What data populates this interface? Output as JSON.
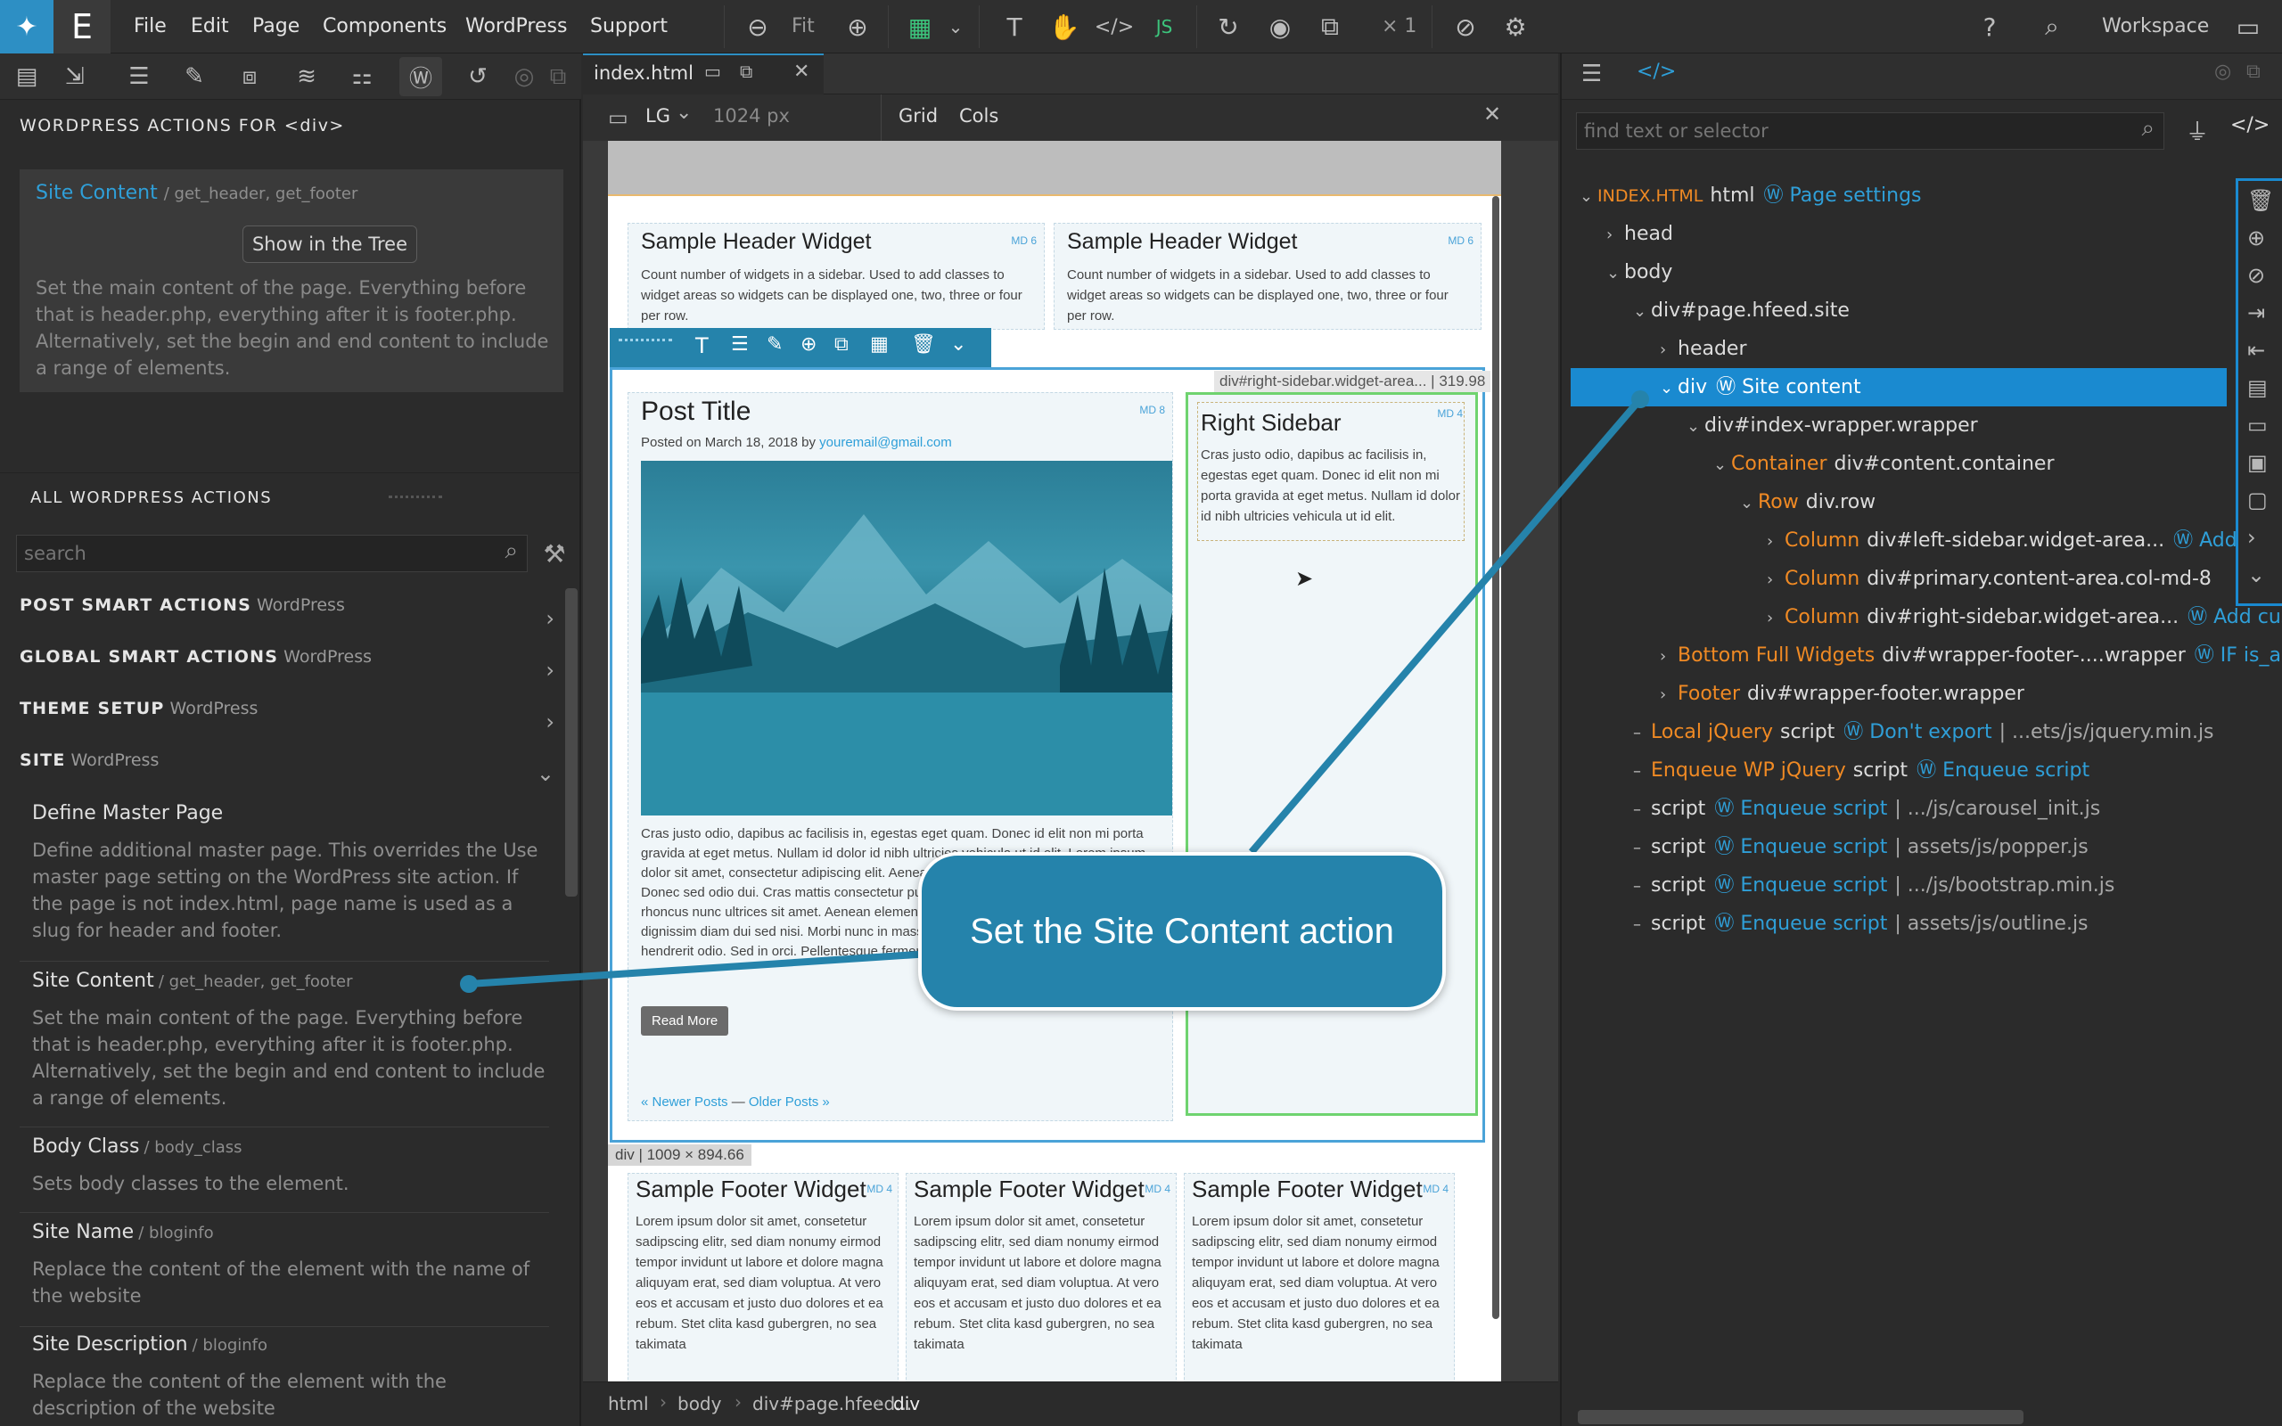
{
  "menubar": {
    "items": [
      "File",
      "Edit",
      "Page",
      "Components",
      "WordPress",
      "Support"
    ],
    "fit_label": "Fit",
    "multiplier": "× 1",
    "workspace": "Workspace"
  },
  "left_panel": {
    "heading": "WORDPRESS ACTIONS FOR  <div>",
    "current_action": {
      "title": "Site Content",
      "sub": "/ get_header, get_footer",
      "button": "Show in the Tree",
      "description": "Set the main content of the page. Everything before that is header.php, everything after it is footer.php. Alternatively, set the begin and end content to include a range of elements."
    },
    "all_heading": "ALL WORDPRESS ACTIONS",
    "search_placeholder": "search",
    "categories": [
      {
        "title": "POST SMART ACTIONS",
        "sub": "WordPress"
      },
      {
        "title": "GLOBAL SMART ACTIONS",
        "sub": "WordPress"
      },
      {
        "title": "THEME SETUP",
        "sub": "WordPress"
      },
      {
        "title": "SITE",
        "sub": "WordPress"
      }
    ],
    "actions": [
      {
        "title": "Define Master Page",
        "sub": "",
        "description": "Define additional master page. This overrides the Use master page setting on the WordPress site action. If the page is not index.html, page name is used as a slug for header and footer."
      },
      {
        "title": "Site Content",
        "sub": "/ get_header, get_footer",
        "description": "Set the main content of the page. Everything before that is header.php, everything after it is footer.php. Alternatively, set the begin and end content to include a range of elements."
      },
      {
        "title": "Body Class",
        "sub": "/ body_class",
        "description": "Sets body classes to the element."
      },
      {
        "title": "Site Name",
        "sub": "/ bloginfo",
        "description": "Replace the content of the element with the name of the website"
      },
      {
        "title": "Site Description",
        "sub": "/ bloginfo",
        "description": "Replace the content of the element with the description of the website"
      }
    ]
  },
  "center": {
    "tab_name": "index.html",
    "viewport": "LG",
    "viewport_px": "1024 px",
    "grid": "Grid",
    "cols": "Cols",
    "breadcrumb": [
      "html",
      "body",
      "div#page.hfeed...",
      "div"
    ],
    "page": {
      "header_widgets": [
        {
          "title": "Sample Header Widget",
          "md": "MD 6",
          "text": "Count number of widgets in a sidebar. Used to add classes to widget areas so widgets can be displayed one, two, three or four per row."
        },
        {
          "title": "Sample Header Widget",
          "md": "MD 6",
          "text": "Count number of widgets in a sidebar. Used to add classes to widget areas so widgets can be displayed one, two, three or four per row."
        }
      ],
      "post": {
        "title": "Post Title",
        "md": "MD 8",
        "meta_prefix": "Posted on March 18, 2018 by",
        "meta_email": "youremail@gmail.com",
        "body": "Cras justo odio, dapibus ac facilisis in, egestas eget quam. Donec id elit non mi porta gravida at eget metus. Nullam id dolor id nibh ultricies vehicula ut id elit. Lorem ipsum dolor sit amet, consectetur adipiscing elit. Aenean lacinia bibendum nulla sed consectetur. Donec sed odio dui. Cras mattis consectetur purus sit amet fermentum. neque, nec rhoncus nunc ultrices sit amet. Aenean elementum, erat at aliquet hendrerit, elit nisi dignissim diam dui sed nisi. Morbi nunc in massa ut lectus. fringilla. Maecenas at hendrerit odio. Sed in orci. Pellentesque fermentum nisl purus, et iaculis",
        "read_more": "Read More",
        "newer": "« Newer Posts",
        "dash": "—",
        "older": "Older Posts »"
      },
      "sidebar": {
        "label": "div#right-sidebar.widget-area... | 319.98",
        "title": "Right Sidebar",
        "md": "MD 4",
        "text": "Cras justo odio, dapibus ac facilisis in, egestas eget quam. Donec id elit non mi porta gravida at eget metus. Nullam id dolor id nibh ultricies vehicula ut id elit."
      },
      "div_size": "div | 1009 × 894.66",
      "footer_widgets": [
        {
          "title": "Sample Footer Widget",
          "md": "MD 4",
          "text": "Lorem ipsum dolor sit amet, consetetur sadipscing elitr, sed diam nonumy eirmod tempor invidunt ut labore et dolore magna aliquyam erat, sed diam voluptua. At vero eos et accusam et justo duo dolores et ea rebum. Stet clita kasd gubergren, no sea takimata"
        },
        {
          "title": "Sample Footer Widget",
          "md": "MD 4",
          "text": "Lorem ipsum dolor sit amet, consetetur sadipscing elitr, sed diam nonumy eirmod tempor invidunt ut labore et dolore magna aliquyam erat, sed diam voluptua. At vero eos et accusam et justo duo dolores et ea rebum. Stet clita kasd gubergren, no sea takimata"
        },
        {
          "title": "Sample Footer Widget",
          "md": "MD 4",
          "text": "Lorem ipsum dolor sit amet, consetetur sadipscing elitr, sed diam nonumy eirmod tempor invidunt ut labore et dolore magna aliquyam erat, sed diam voluptua. At vero eos et accusam et justo duo dolores et ea rebum. Stet clita kasd gubergren, no sea takimata"
        }
      ]
    }
  },
  "callout": "Set the Site Content action",
  "right_panel": {
    "search_placeholder": "find text or selector",
    "tree": [
      {
        "depth": 0,
        "caret": "v",
        "tag": "INDEX.HTML",
        "name": "html",
        "wp": "Page settings",
        "rest": ""
      },
      {
        "depth": 1,
        "caret": ">",
        "tag": "",
        "name": "head",
        "wp": "",
        "rest": ""
      },
      {
        "depth": 1,
        "caret": "v",
        "tag": "",
        "name": "body",
        "wp": "",
        "rest": ""
      },
      {
        "depth": 2,
        "caret": "v",
        "tag": "",
        "name": "div#page.hfeed.site",
        "wp": "",
        "rest": ""
      },
      {
        "depth": 3,
        "caret": ">",
        "tag": "",
        "name": "header",
        "wp": "",
        "rest": ""
      },
      {
        "depth": 3,
        "caret": "v",
        "tag": "",
        "name": "div",
        "wp": "Site content",
        "rest": "",
        "selected": true
      },
      {
        "depth": 4,
        "caret": "v",
        "tag": "",
        "name": "div#index-wrapper.wrapper",
        "wp": "",
        "rest": ""
      },
      {
        "depth": 5,
        "caret": "v",
        "tag": "Container",
        "name": "div#content.container",
        "wp": "",
        "rest": ""
      },
      {
        "depth": 6,
        "caret": "v",
        "tag": "Row",
        "name": "div.row",
        "wp": "",
        "rest": ""
      },
      {
        "depth": 7,
        "caret": ">",
        "tag": "Column",
        "name": "div#left-sidebar.widget-area...",
        "wp": "Add cu",
        "rest": ""
      },
      {
        "depth": 7,
        "caret": ">",
        "tag": "Column",
        "name": "div#primary.content-area.col-md-8",
        "wp": "",
        "rest": ""
      },
      {
        "depth": 7,
        "caret": ">",
        "tag": "Column",
        "name": "div#right-sidebar.widget-area...",
        "wp": "Add custor",
        "rest": ""
      },
      {
        "depth": 3,
        "caret": ">",
        "tag": "Bottom Full Widgets",
        "name": "div#wrapper-footer-....wrapper",
        "wp": "IF is_active",
        "rest": ""
      },
      {
        "depth": 3,
        "caret": ">",
        "tag": "Footer",
        "name": "div#wrapper-footer.wrapper",
        "wp": "",
        "rest": ""
      },
      {
        "depth": 2,
        "caret": "-",
        "tag": "Local jQuery",
        "name": "script",
        "wp": "Don't export",
        "rest": "| ...ets/js/jquery.min.js"
      },
      {
        "depth": 2,
        "caret": "-",
        "tag": "Enqueue WP jQuery",
        "name": "script",
        "wp": "Enqueue script",
        "rest": ""
      },
      {
        "depth": 2,
        "caret": "-",
        "tag": "",
        "name": "script",
        "wp": "Enqueue script",
        "rest": "| .../js/carousel_init.js"
      },
      {
        "depth": 2,
        "caret": "-",
        "tag": "",
        "name": "script",
        "wp": "Enqueue script",
        "rest": "| assets/js/popper.js"
      },
      {
        "depth": 2,
        "caret": "-",
        "tag": "",
        "name": "script",
        "wp": "Enqueue script",
        "rest": "| .../js/bootstrap.min.js"
      },
      {
        "depth": 2,
        "caret": "-",
        "tag": "",
        "name": "script",
        "wp": "Enqueue script",
        "rest": "| assets/js/outline.js"
      }
    ]
  },
  "colors": {
    "accent": "#2d8fc4",
    "selection": "#1a8ad0",
    "tag_orange": "#f08a24",
    "link_blue": "#2f9fd8",
    "callout": "#2583ab"
  }
}
